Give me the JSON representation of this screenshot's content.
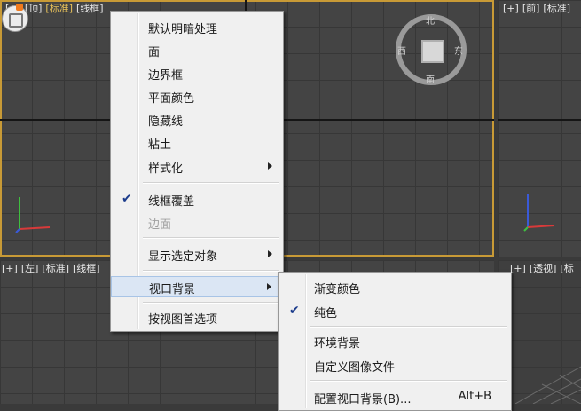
{
  "viewports": {
    "top": {
      "labels": [
        "[+]",
        "[顶]",
        "[标准]",
        "[线框]"
      ]
    },
    "front": {
      "labels": [
        "[+]",
        "[前]",
        "[标准]"
      ]
    },
    "left": {
      "labels": [
        "[+]",
        "[左]",
        "[标准]",
        "[线框]"
      ]
    },
    "persp": {
      "labels": [
        "[+]",
        "[透视]",
        "[标"
      ]
    }
  },
  "viewcube": {
    "north": "北",
    "south": "南",
    "east": "东",
    "west": "西"
  },
  "context_menu": {
    "items": [
      {
        "label": "默认明暗处理"
      },
      {
        "label": "面"
      },
      {
        "label": "边界框"
      },
      {
        "label": "平面颜色"
      },
      {
        "label": "隐藏线"
      },
      {
        "label": "粘土"
      },
      {
        "label": "样式化",
        "submenu": true
      },
      {
        "label": "线框覆盖",
        "checked": true
      },
      {
        "label": "边面",
        "disabled": true
      },
      {
        "label": "显示选定对象",
        "submenu": true
      },
      {
        "label": "视口背景",
        "submenu": true,
        "highlighted": true
      },
      {
        "label": "按视图首选项"
      }
    ]
  },
  "submenu": {
    "items": [
      {
        "label": "渐变颜色"
      },
      {
        "label": "纯色",
        "checked": true
      },
      {
        "label": "环境背景"
      },
      {
        "label": "自定义图像文件"
      },
      {
        "label": "配置视口背景(B)...",
        "shortcut": "Alt+B"
      }
    ]
  },
  "colors": {
    "active_border": "#c89a36",
    "highlight": "#dbe6f4",
    "check": "#1c3c8c"
  }
}
